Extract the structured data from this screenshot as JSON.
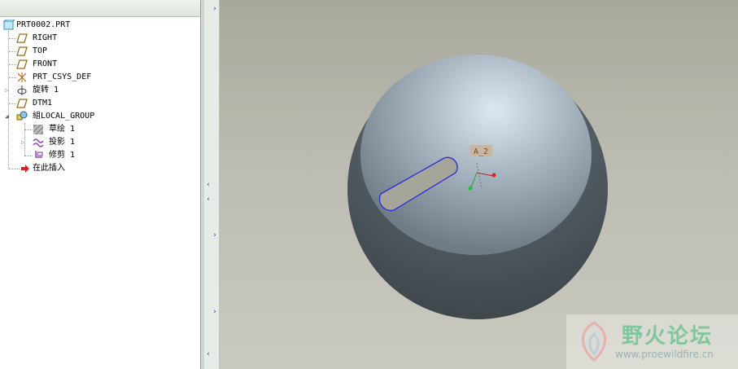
{
  "model_tree": {
    "items": [
      {
        "label": "PRT0002.PRT",
        "icon": "part-icon"
      },
      {
        "label": "RIGHT",
        "icon": "datum-plane-icon"
      },
      {
        "label": "TOP",
        "icon": "datum-plane-icon"
      },
      {
        "label": "FRONT",
        "icon": "datum-plane-icon"
      },
      {
        "label": "PRT_CSYS_DEF",
        "icon": "csys-icon"
      },
      {
        "label": "旋转 1",
        "icon": "revolve-icon"
      },
      {
        "label": "DTM1",
        "icon": "datum-plane-icon"
      },
      {
        "label": "組LOCAL_GROUP",
        "icon": "group-icon"
      },
      {
        "label": "草绘 1",
        "icon": "sketch-icon"
      },
      {
        "label": "投影 1",
        "icon": "project-icon"
      },
      {
        "label": "修剪 1",
        "icon": "trim-icon"
      },
      {
        "label": "在此插入",
        "icon": "insert-here-arrow-icon"
      }
    ]
  },
  "viewport": {
    "csys_label": "A_2"
  },
  "watermark": {
    "name": "野火论坛",
    "url": "www.proewildfire.cn"
  },
  "colors": {
    "tree_bg": "#ffffff",
    "viewport_bg": "#bdbcb2",
    "sketch_curve": "#2a2adf",
    "watermark_green": "#7fc79a"
  }
}
